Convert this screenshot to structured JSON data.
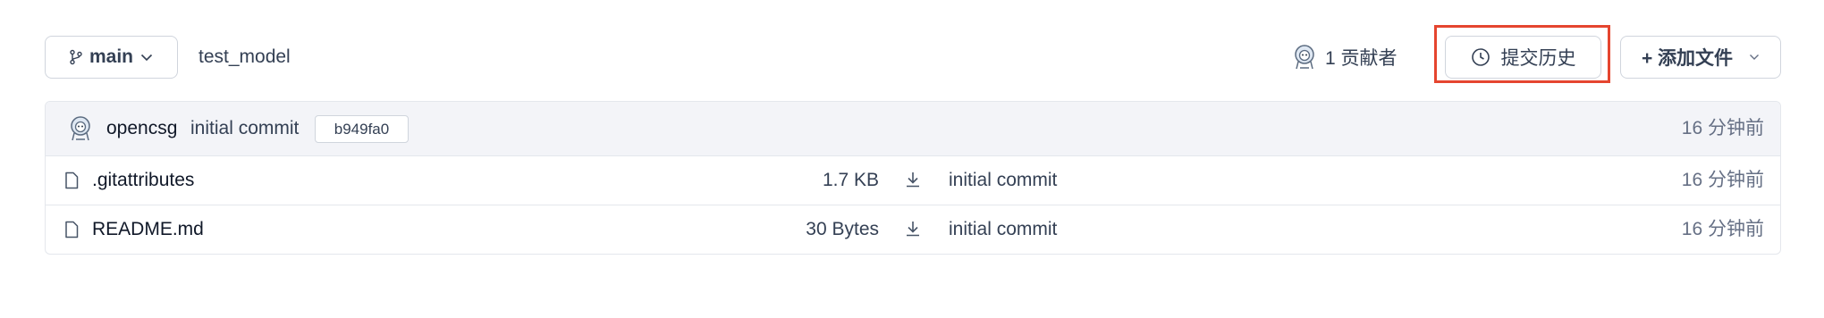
{
  "toolbar": {
    "branch_label": "main",
    "repo_name": "test_model",
    "contributors_label": "1 贡献者",
    "history_button_label": "提交历史",
    "add_file_label": "+ 添加文件"
  },
  "latest_commit": {
    "author": "opencsg",
    "message": "initial commit",
    "hash": "b949fa0",
    "time": "16 分钟前"
  },
  "files": [
    {
      "name": ".gitattributes",
      "size": "1.7 KB",
      "commit": "initial commit",
      "time": "16 分钟前"
    },
    {
      "name": "README.md",
      "size": "30 Bytes",
      "commit": "initial commit",
      "time": "16 分钟前"
    }
  ],
  "icons": {
    "branch": "git-branch-icon",
    "chevron": "chevron-down-icon",
    "avatar": "avatar-icon",
    "clock": "clock-icon",
    "file": "file-icon",
    "download": "download-icon"
  },
  "colors": {
    "highlight": "#e5452f",
    "border": "#d0d5dd",
    "header_bg": "#f3f4f8"
  }
}
